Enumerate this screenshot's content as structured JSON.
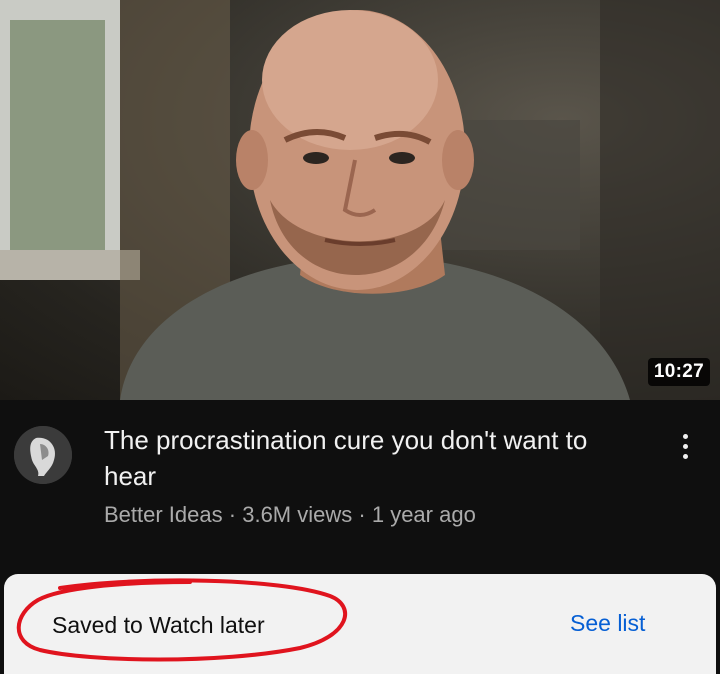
{
  "video": {
    "duration": "10:27",
    "title": "The procrastination cure you don't want to hear",
    "channel": "Better Ideas",
    "views": "3.6M views",
    "age": "1 year ago",
    "separator": "·"
  },
  "snackbar": {
    "message": "Saved to Watch later",
    "action_label": "See list"
  },
  "icons": {
    "more": "more-vert-icon"
  },
  "colors": {
    "background": "#0f0f0f",
    "title_text": "#f1f1f1",
    "secondary_text": "#aaaaaa",
    "snackbar_bg": "#f2f2f2",
    "action_blue": "#065fd4",
    "annotation_red": "#e0141e"
  }
}
